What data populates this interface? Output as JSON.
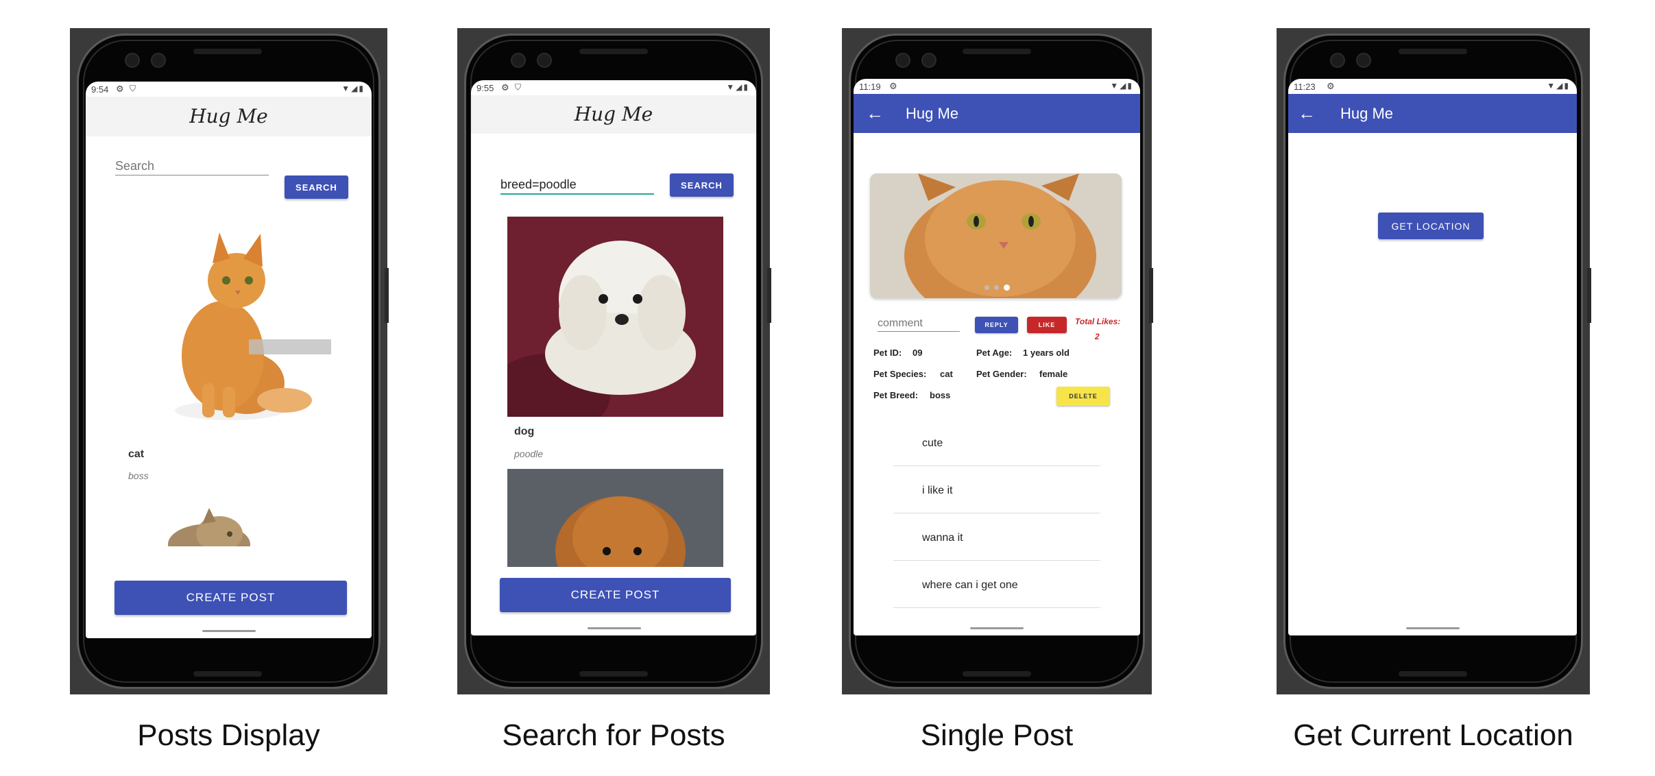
{
  "phones": [
    {
      "status_time": "9:54",
      "header_title": "Hug Me",
      "search_placeholder": "Search",
      "search_button": "SEARCH",
      "posts": [
        {
          "title": "cat",
          "subtitle": "boss"
        }
      ],
      "create_post_button": "CREATE POST",
      "caption": "Posts Display"
    },
    {
      "status_time": "9:55",
      "header_title": "Hug Me",
      "search_value": "breed=poodle",
      "search_button": "SEARCH",
      "posts": [
        {
          "title": "dog",
          "subtitle": "poodle"
        }
      ],
      "create_post_button": "CREATE POST",
      "caption": "Search for Posts"
    },
    {
      "status_time": "11:19",
      "header_title": "Hug Me",
      "comment_placeholder": "comment",
      "reply_button": "REPLY",
      "like_button": "LIKE",
      "total_likes_label": "Total Likes:",
      "total_likes_value": "2",
      "pet_id_label": "Pet ID:",
      "pet_id_value": "09",
      "pet_age_label": "Pet Age:",
      "pet_age_value": "1  years old",
      "pet_species_label": "Pet Species:",
      "pet_species_value": "cat",
      "pet_gender_label": "Pet Gender:",
      "pet_gender_value": "female",
      "pet_breed_label": "Pet Breed:",
      "pet_breed_value": "boss",
      "delete_button": "DELETE",
      "comments": [
        "cute",
        "i like it",
        "wanna it",
        "where can i get one"
      ],
      "carousel_active": 3,
      "carousel_count": 3,
      "caption": "Single Post"
    },
    {
      "status_time": "11:23",
      "header_title": "Hug Me",
      "get_location_button": "GET LOCATION",
      "caption": "Get Current Location"
    }
  ],
  "colors": {
    "primary": "#3e51b5",
    "like_red": "#c6282a",
    "delete_yellow": "#f7e449",
    "accent_teal": "#26a69a"
  },
  "icons": [
    "gear-icon",
    "shield-icon",
    "wifi-icon",
    "signal-icon",
    "battery-icon",
    "back-arrow-icon"
  ]
}
